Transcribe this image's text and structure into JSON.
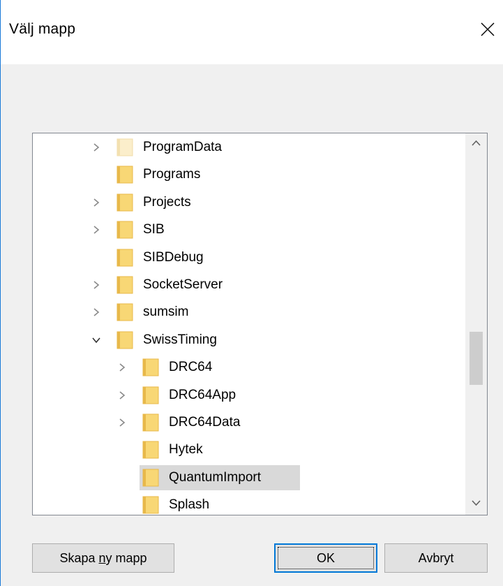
{
  "window": {
    "title": "Välj mapp",
    "close_icon": "close-icon"
  },
  "tree": {
    "rows": [
      {
        "label": "ProgramData",
        "depth": 0,
        "expander": "collapsed",
        "folder_style": "faded",
        "selected": false
      },
      {
        "label": "Programs",
        "depth": 0,
        "expander": "none",
        "folder_style": "normal",
        "selected": false
      },
      {
        "label": "Projects",
        "depth": 0,
        "expander": "collapsed",
        "folder_style": "normal",
        "selected": false
      },
      {
        "label": "SIB",
        "depth": 0,
        "expander": "collapsed",
        "folder_style": "normal",
        "selected": false
      },
      {
        "label": "SIBDebug",
        "depth": 0,
        "expander": "none",
        "folder_style": "normal",
        "selected": false
      },
      {
        "label": "SocketServer",
        "depth": 0,
        "expander": "collapsed",
        "folder_style": "normal",
        "selected": false
      },
      {
        "label": "sumsim",
        "depth": 0,
        "expander": "collapsed",
        "folder_style": "normal",
        "selected": false
      },
      {
        "label": "SwissTiming",
        "depth": 0,
        "expander": "expanded",
        "folder_style": "normal",
        "selected": false
      },
      {
        "label": "DRC64",
        "depth": 1,
        "expander": "collapsed",
        "folder_style": "normal",
        "selected": false
      },
      {
        "label": "DRC64App",
        "depth": 1,
        "expander": "collapsed",
        "folder_style": "normal",
        "selected": false
      },
      {
        "label": "DRC64Data",
        "depth": 1,
        "expander": "collapsed",
        "folder_style": "normal",
        "selected": false
      },
      {
        "label": "Hytek",
        "depth": 1,
        "expander": "none",
        "folder_style": "normal",
        "selected": false
      },
      {
        "label": "QuantumImport",
        "depth": 1,
        "expander": "none",
        "folder_style": "normal",
        "selected": true
      },
      {
        "label": "Splash",
        "depth": 1,
        "expander": "none",
        "folder_style": "normal",
        "selected": false
      }
    ]
  },
  "scrollbar": {
    "up_icon": "chevron-up-icon",
    "down_icon": "chevron-down-icon",
    "position_fraction": 0.62
  },
  "buttons": {
    "new_folder_prefix": "Skapa ",
    "new_folder_accel": "n",
    "new_folder_suffix": "y mapp",
    "ok": "OK",
    "cancel": "Avbryt"
  },
  "colors": {
    "accent": "#0078d7",
    "folder": "#f8d775",
    "folder_dark": "#e8b84a",
    "selection": "#d9d9d9"
  }
}
